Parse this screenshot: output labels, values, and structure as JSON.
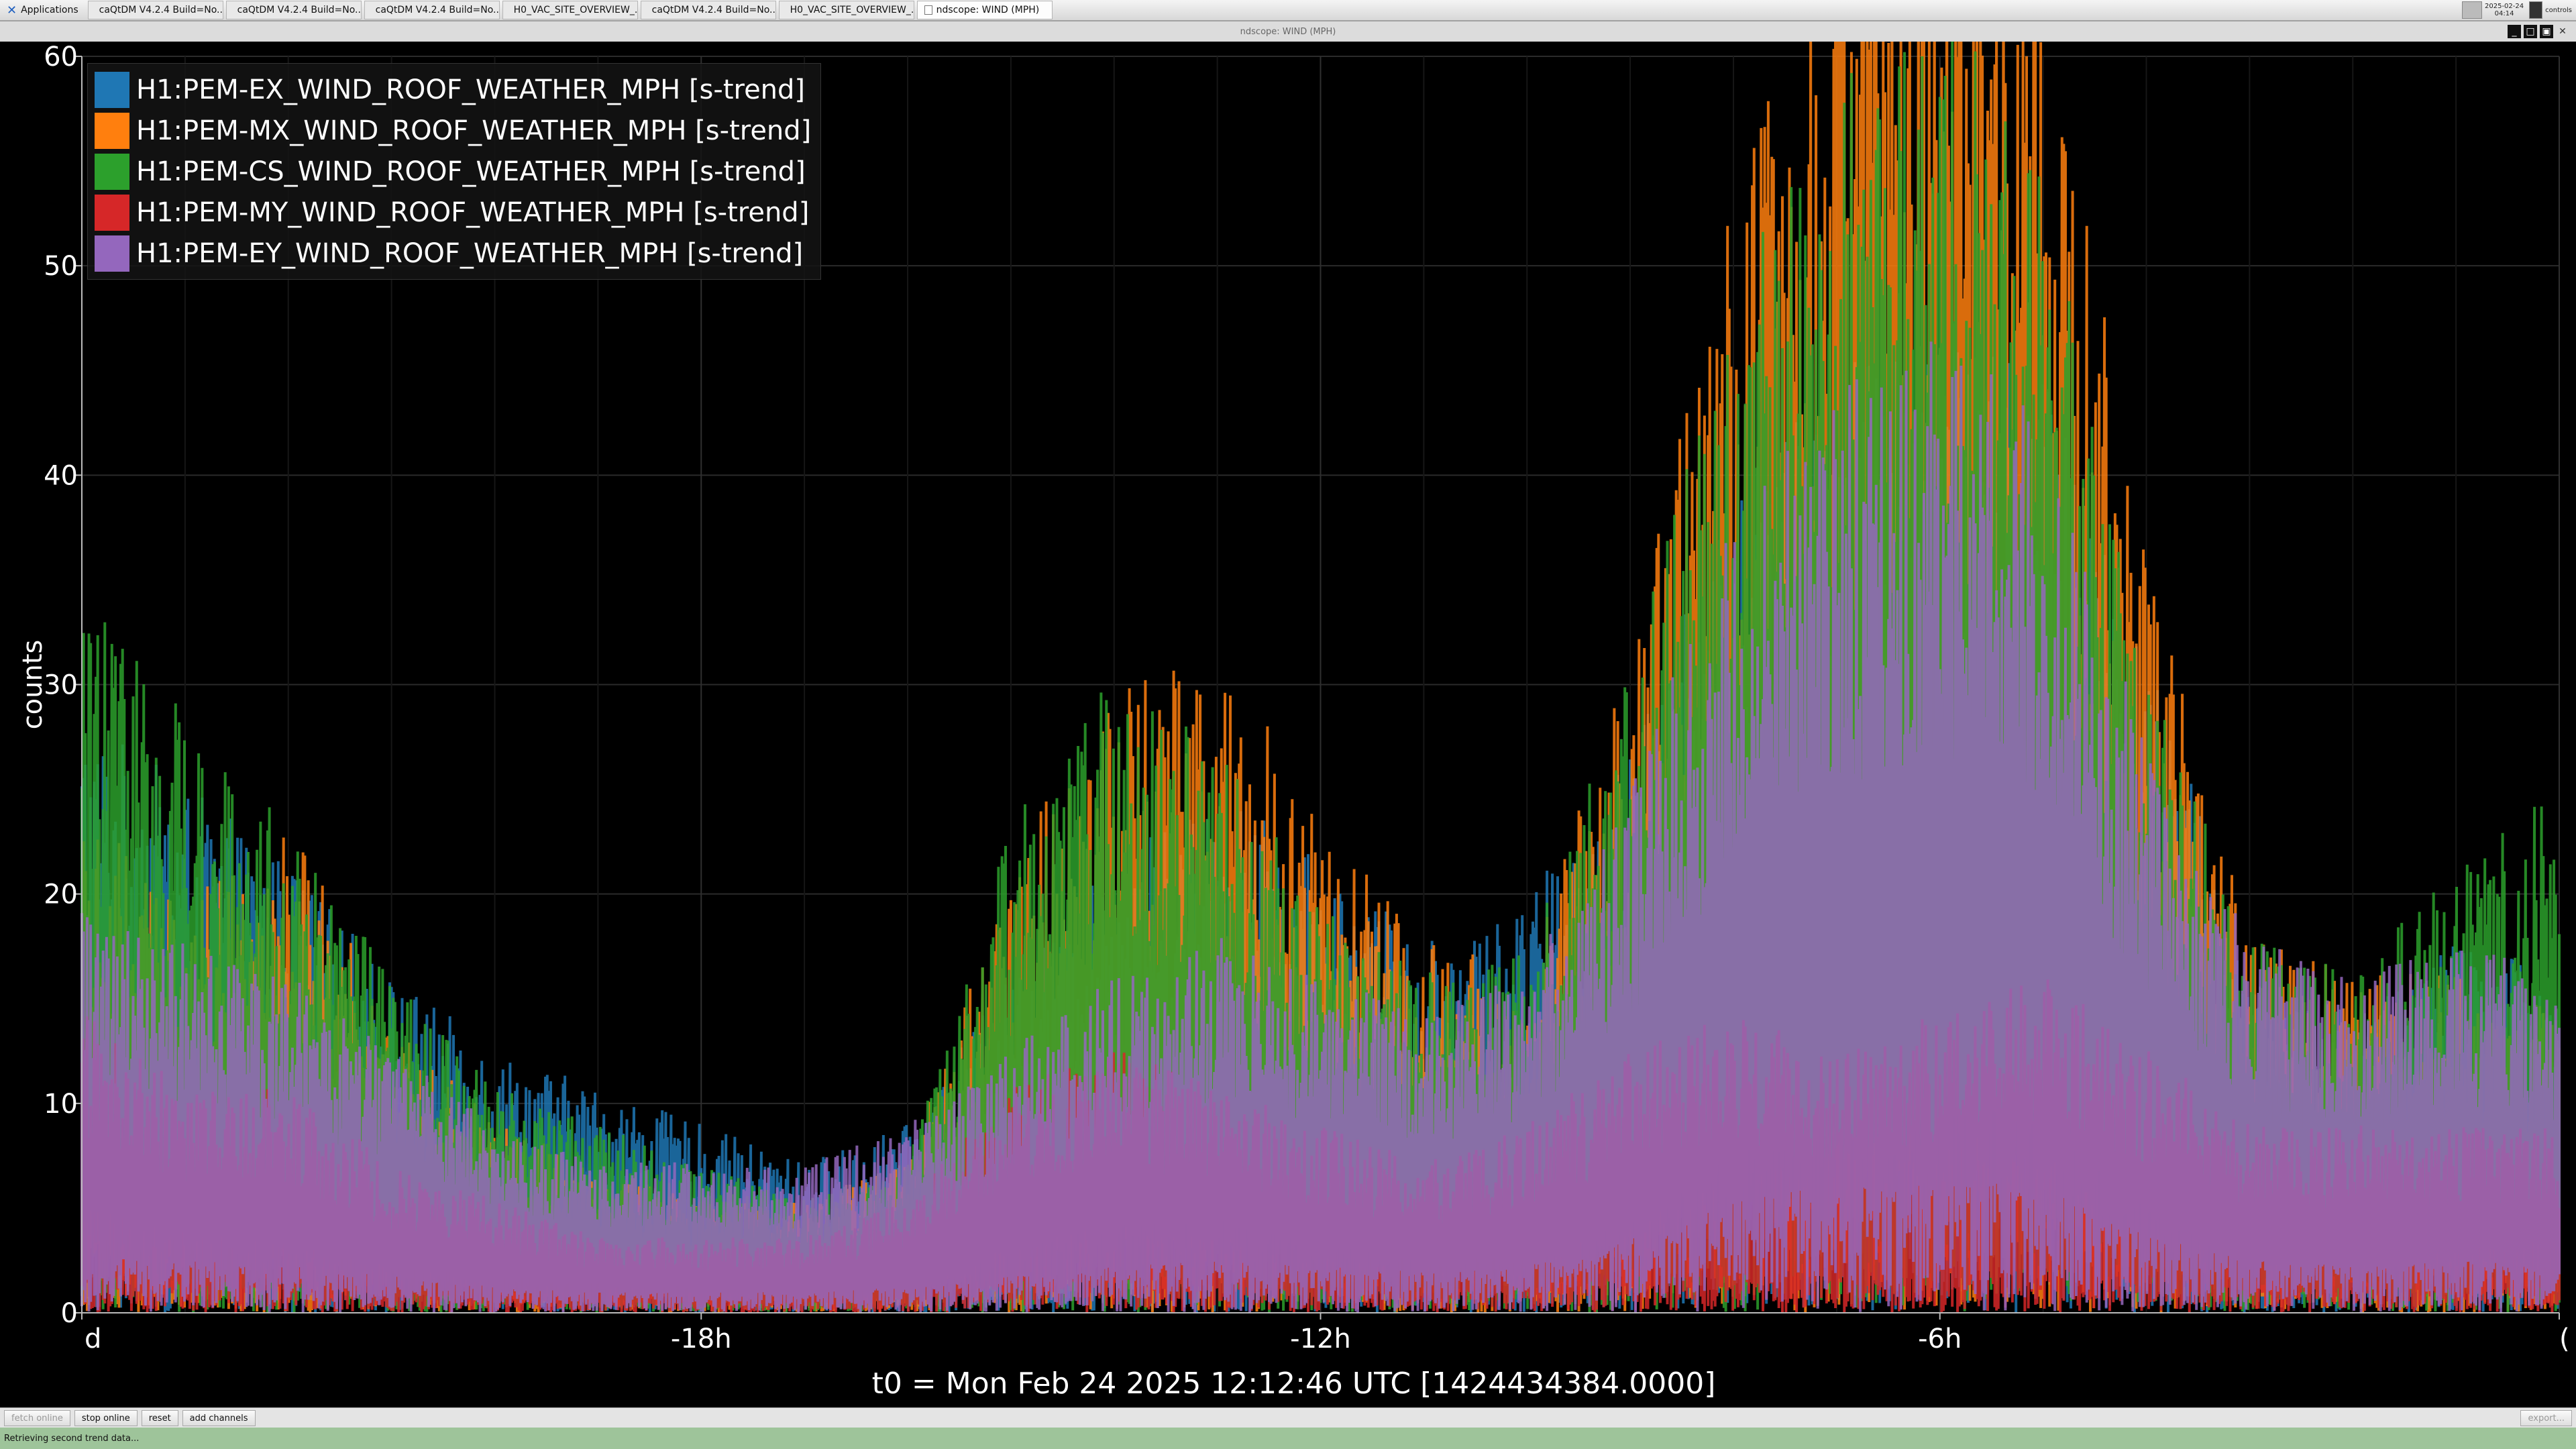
{
  "taskbar": {
    "applications_label": "Applications",
    "items": [
      {
        "label": "caQtDM V4.2.4 Build=No...",
        "icon": "caqtdm-icon"
      },
      {
        "label": "caQtDM V4.2.4 Build=No...",
        "icon": "caqtdm-icon"
      },
      {
        "label": "caQtDM V4.2.4 Build=No...",
        "icon": "caqtdm-icon"
      },
      {
        "label": "H0_VAC_SITE_OVERVIEW_...",
        "icon": "caqtdm-icon"
      },
      {
        "label": "caQtDM V4.2.4 Build=No...",
        "icon": "caqtdm-icon"
      },
      {
        "label": "H0_VAC_SITE_OVERVIEW_...",
        "icon": "caqtdm-icon"
      },
      {
        "label": "ndscope: WIND (MPH)",
        "icon": "document-icon"
      }
    ],
    "tray_date": "2025-02-24",
    "tray_time": "04:14",
    "tray_user": "controls"
  },
  "window": {
    "title": "ndscope: WIND (MPH)"
  },
  "plot": {
    "ylabel": "counts",
    "xlabel": "t0 = Mon Feb 24 2025 12:12:46 UTC [1424434384.0000]",
    "legend": [
      {
        "label": "H1:PEM-EX_WIND_ROOF_WEATHER_MPH [s-trend]",
        "color": "#1f77b4"
      },
      {
        "label": "H1:PEM-MX_WIND_ROOF_WEATHER_MPH [s-trend]",
        "color": "#ff7f0e"
      },
      {
        "label": "H1:PEM-CS_WIND_ROOF_WEATHER_MPH [s-trend]",
        "color": "#2ca02c"
      },
      {
        "label": "H1:PEM-MY_WIND_ROOF_WEATHER_MPH [s-trend]",
        "color": "#d62728"
      },
      {
        "label": "H1:PEM-EY_WIND_ROOF_WEATHER_MPH [s-trend]",
        "color": "#9467bd"
      }
    ]
  },
  "chart_data": {
    "type": "line",
    "title": "",
    "ylabel": "counts",
    "xlabel": "t0 = Mon Feb 24 2025 12:12:46 UTC [1424434384.0000]",
    "xlim": [
      -24,
      0
    ],
    "ylim": [
      0,
      60
    ],
    "grid": true,
    "legend_position": "top-left",
    "x_tick_labels": [
      {
        "x": -24,
        "label": "d"
      },
      {
        "x": -18,
        "label": "-18h"
      },
      {
        "x": -12,
        "label": "-12h"
      },
      {
        "x": -6,
        "label": "-6h"
      },
      {
        "x": 0,
        "label": "("
      }
    ],
    "y_ticks": [
      0,
      10,
      20,
      30,
      40,
      50,
      60
    ],
    "x_hours": [
      -24,
      -23,
      -22,
      -21,
      -20,
      -19,
      -18,
      -17,
      -16,
      -15,
      -14,
      -13,
      -12,
      -11,
      -10,
      -9,
      -8,
      -7,
      -6,
      -5,
      -4,
      -3,
      -2,
      -1,
      0
    ],
    "series": [
      {
        "name": "H1:PEM-EX_WIND_ROOF_WEATHER_MPH [s-trend]",
        "color": "#1f77b4",
        "values": [
          16,
          14,
          12,
          9,
          7,
          6,
          5,
          4,
          5,
          9,
          12,
          14,
          12,
          10,
          11,
          15,
          22,
          25,
          27,
          25,
          18,
          9,
          8,
          10,
          9
        ]
      },
      {
        "name": "H1:PEM-MX_WIND_ROOF_WEATHER_MPH [s-trend]",
        "color": "#ff7f0e",
        "values": [
          14,
          11,
          13,
          8,
          5,
          4,
          3,
          3,
          4,
          12,
          17,
          18,
          13,
          10,
          9,
          18,
          30,
          38,
          42,
          36,
          20,
          10,
          9,
          9,
          8
        ]
      },
      {
        "name": "H1:PEM-CS_WIND_ROOF_WEATHER_MPH [s-trend]",
        "color": "#2ca02c",
        "values": [
          20,
          16,
          13,
          9,
          6,
          5,
          4,
          3,
          4,
          13,
          17,
          15,
          11,
          9,
          10,
          17,
          27,
          33,
          35,
          31,
          17,
          10,
          9,
          12,
          14
        ]
      },
      {
        "name": "H1:PEM-MY_WIND_ROOF_WEATHER_MPH [s-trend]",
        "color": "#d62728",
        "values": [
          8,
          6,
          6,
          4,
          3,
          2,
          2,
          2,
          3,
          6,
          7,
          6,
          5,
          4,
          5,
          7,
          8,
          7,
          8,
          9,
          7,
          5,
          5,
          5,
          5
        ]
      },
      {
        "name": "H1:PEM-EY_WIND_ROOF_WEATHER_MPH [s-trend]",
        "color": "#9467bd",
        "values": [
          11,
          10,
          9,
          7,
          5,
          4,
          4,
          4,
          5,
          7,
          9,
          10,
          9,
          8,
          9,
          14,
          21,
          25,
          26,
          24,
          15,
          10,
          9,
          10,
          9
        ]
      }
    ]
  },
  "controls": {
    "buttons": [
      {
        "label": "fetch online",
        "enabled": false,
        "name": "fetch-online-button"
      },
      {
        "label": "stop online",
        "enabled": true,
        "name": "stop-online-button"
      },
      {
        "label": "reset",
        "enabled": true,
        "name": "reset-button"
      },
      {
        "label": "add channels",
        "enabled": true,
        "name": "add-channels-button"
      }
    ],
    "right_label": "export..."
  },
  "status": {
    "message": "Retrieving second trend data..."
  }
}
